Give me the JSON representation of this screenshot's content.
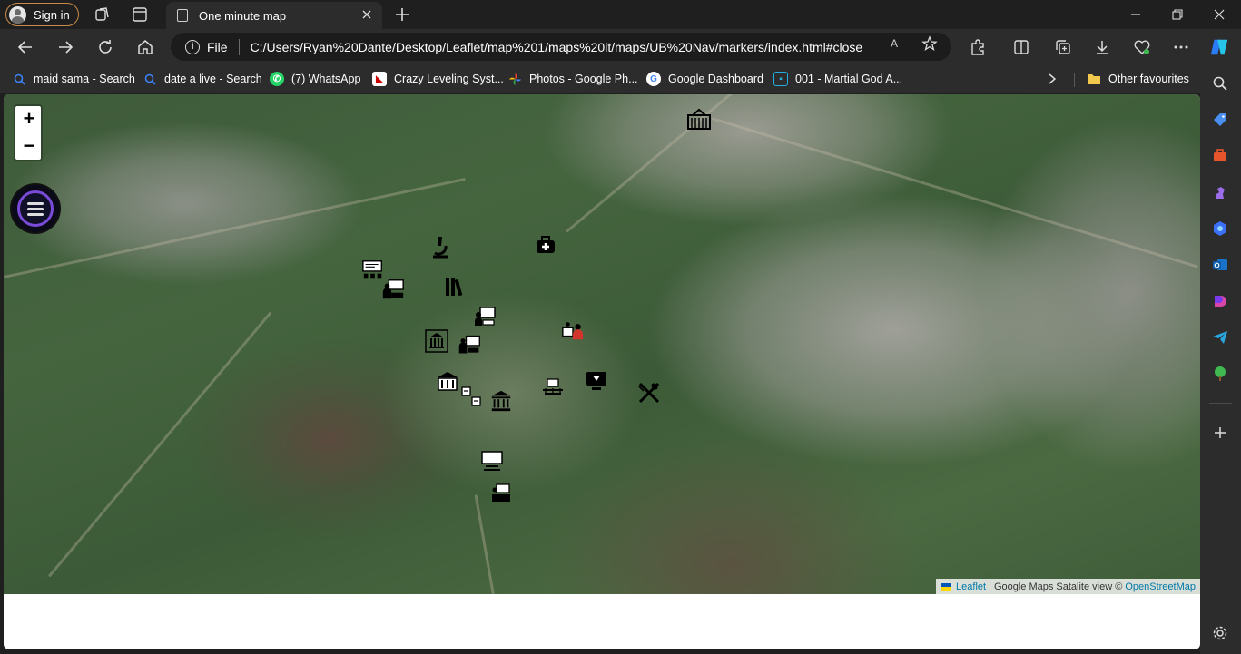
{
  "browser": {
    "signin_label": "Sign in",
    "tab_title": "One minute map",
    "address": {
      "info_label": "File",
      "url": "C:/Users/Ryan%20Dante/Desktop/Leaflet/map%201/maps%20it/maps/UB%20Nav/markers/index.html#close"
    },
    "bookmarks": [
      {
        "label": "maid sama - Search",
        "icon": "search-icon"
      },
      {
        "label": "date a live - Search",
        "icon": "search-icon"
      },
      {
        "label": "(7) WhatsApp",
        "icon": "whatsapp-icon"
      },
      {
        "label": "Crazy Leveling Syst...",
        "icon": "site-icon"
      },
      {
        "label": "Photos - Google Ph...",
        "icon": "google-photos-icon"
      },
      {
        "label": "Google Dashboard",
        "icon": "google-icon"
      },
      {
        "label": "001 - Martial God A...",
        "icon": "bilibili-icon"
      }
    ],
    "other_favourites": "Other favourites",
    "read_aloud_label": "A"
  },
  "map": {
    "zoom_in": "+",
    "zoom_out": "−",
    "attribution": {
      "leaflet": "Leaflet",
      "sep": "|",
      "text": "Google Maps Satalite view ©",
      "osm": "OpenStreetMap"
    },
    "markers": [
      {
        "name": "gate-marker",
        "icon": "gate-icon"
      },
      {
        "name": "laboratory-marker",
        "icon": "microscope-icon"
      },
      {
        "name": "health-center-marker",
        "icon": "medical-kit-icon"
      },
      {
        "name": "lecture-hall-marker",
        "icon": "classroom-icon"
      },
      {
        "name": "teacher-marker",
        "icon": "presentation-icon"
      },
      {
        "name": "library-marker",
        "icon": "books-icon"
      },
      {
        "name": "presentation-board-marker",
        "icon": "board-icon"
      },
      {
        "name": "administration-marker",
        "icon": "staff-icon"
      },
      {
        "name": "museum-marker",
        "icon": "museum-icon"
      },
      {
        "name": "classroom-marker",
        "icon": "teaching-icon"
      },
      {
        "name": "faculty-building-marker",
        "icon": "building-icon"
      },
      {
        "name": "exam-hall-marker",
        "icon": "desks-icon"
      },
      {
        "name": "bank-marker",
        "icon": "bank-icon"
      },
      {
        "name": "it-center-marker",
        "icon": "computer-icon"
      },
      {
        "name": "restaurant-marker",
        "icon": "fork-knife-icon"
      },
      {
        "name": "amphitheater-marker",
        "icon": "auditorium-icon"
      },
      {
        "name": "cinema-marker",
        "icon": "screen-icon"
      },
      {
        "name": "training-room-marker",
        "icon": "training-icon"
      }
    ]
  }
}
